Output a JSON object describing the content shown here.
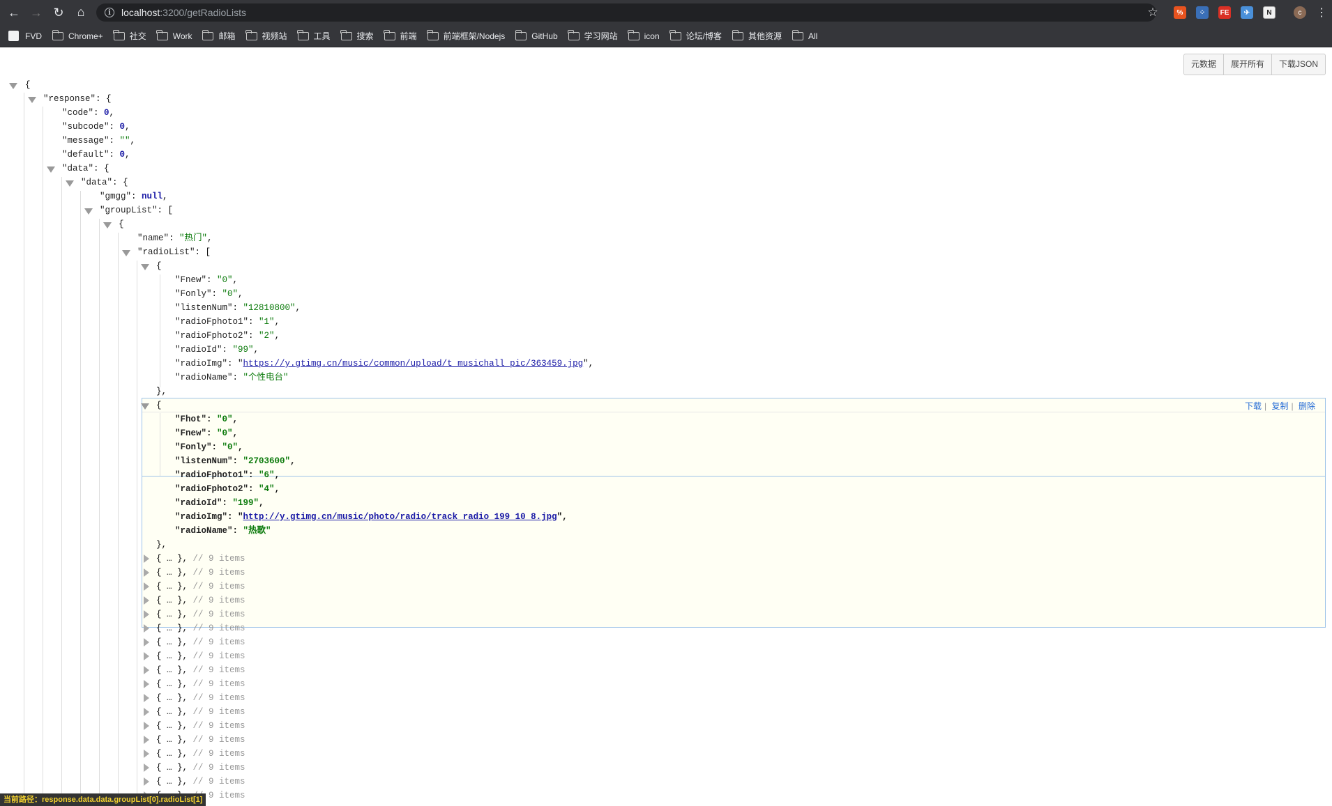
{
  "browser": {
    "url_host": "localhost",
    "url_path": ":3200/getRadioLists",
    "avatar_letter": "c"
  },
  "bookmarks": [
    "FVD",
    "Chrome+",
    "社交",
    "Work",
    "邮箱",
    "视频站",
    "工具",
    "搜索",
    "前端",
    "前端框架/Nodejs",
    "GitHub",
    "学习网站",
    "icon",
    "论坛/博客",
    "其他资源",
    "All"
  ],
  "toolbar_buttons": {
    "meta": "元数据",
    "expand": "展开所有",
    "download": "下载JSON"
  },
  "json": {
    "response_key": "\"response\"",
    "code": "0",
    "subcode": "0",
    "message": "\"\"",
    "default": "0",
    "gmgg": "null",
    "group_name": "\"热门\"",
    "radio1": {
      "Fnew": "\"0\"",
      "Fonly": "\"0\"",
      "listenNum": "\"12810800\"",
      "radioFphoto1": "\"1\"",
      "radioFphoto2": "\"2\"",
      "radioId": "\"99\"",
      "radioImg": "https://y.gtimg.cn/music/common/upload/t_musichall_pic/363459.jpg",
      "radioName": "\"个性电台\""
    },
    "radio2": {
      "Fhot": "\"0\"",
      "Fnew": "\"0\"",
      "Fonly": "\"0\"",
      "listenNum": "\"2703600\"",
      "radioFphoto1": "\"6\"",
      "radioFphoto2": "\"4\"",
      "radioId": "\"199\"",
      "radioImg": "http://y.gtimg.cn/music/photo/radio/track_radio_199_10_8.jpg",
      "radioName": "\"热歌\""
    },
    "collapsed_comment": "// 9 items",
    "collapsed_count": 18
  },
  "row_actions": {
    "download": "下载",
    "copy": "复制",
    "delete": "删除"
  },
  "status_bar": "当前路径：response.data.data.groupList[0].radioList[1]"
}
